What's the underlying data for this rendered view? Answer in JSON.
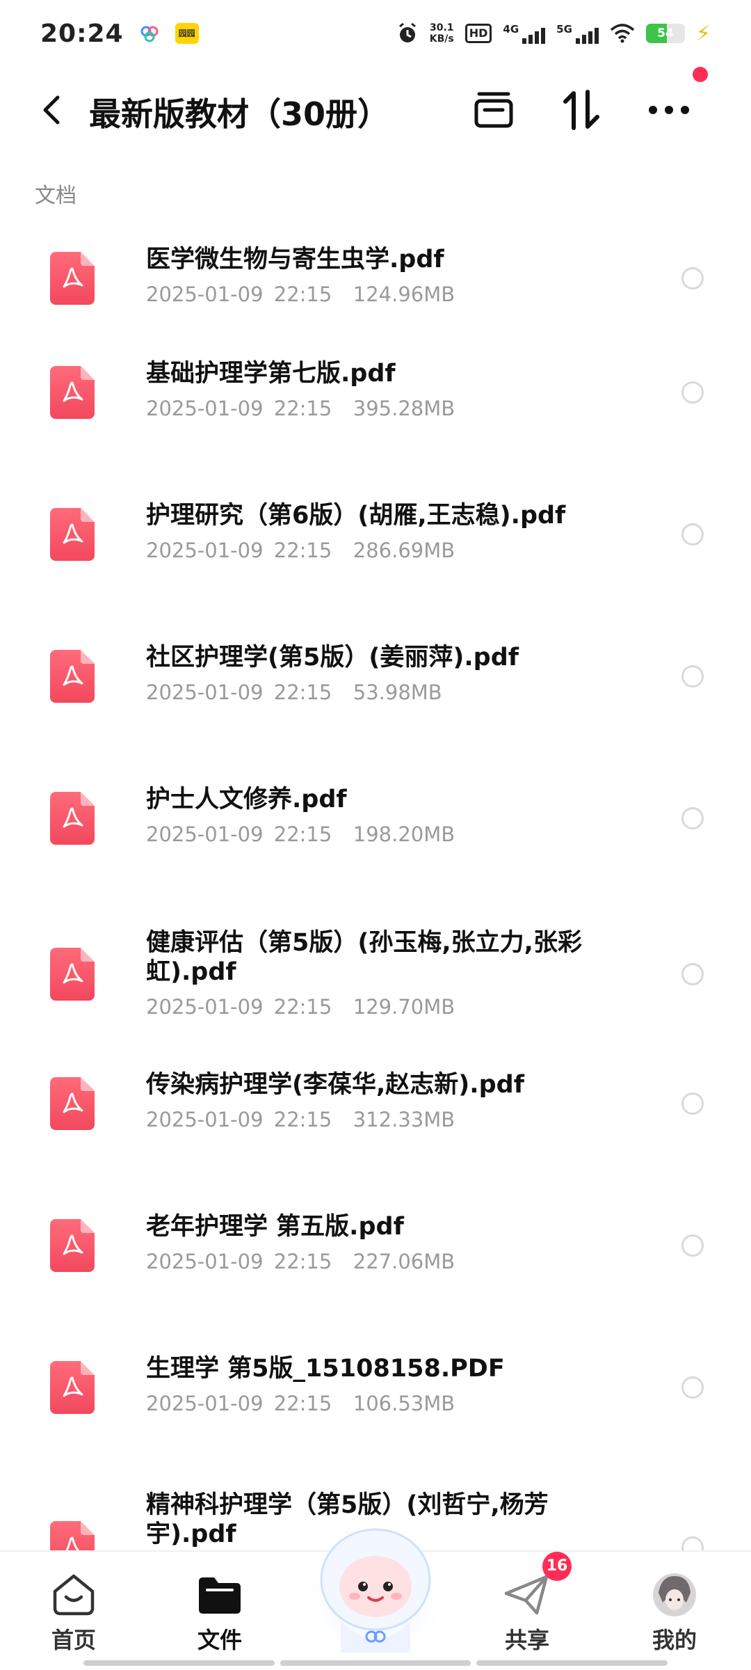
{
  "status_bar": {
    "time": "20:24",
    "app_badge": "园园",
    "net_speed_value": "30.1",
    "net_speed_unit": "KB/s",
    "hd_label": "HD",
    "sig1_label": "4G",
    "sig2_label": "5G",
    "battery_level": "54"
  },
  "header": {
    "title": "最新版教材（30册）"
  },
  "section": {
    "label": "文档"
  },
  "files": [
    {
      "name": "医学微生物与寄生虫学.pdf",
      "date": "2025-01-09 22:15",
      "size": "124.96MB"
    },
    {
      "name": "基础护理学第七版.pdf",
      "date": "2025-01-09 22:15",
      "size": "395.28MB"
    },
    {
      "name": "护理研究（第6版）(胡雁,王志稳).pdf",
      "date": "2025-01-09 22:15",
      "size": "286.69MB"
    },
    {
      "name": "社区护理学(第5版）(姜丽萍).pdf",
      "date": "2025-01-09 22:15",
      "size": "53.98MB"
    },
    {
      "name": "护士人文修养.pdf",
      "date": "2025-01-09 22:15",
      "size": "198.20MB"
    },
    {
      "name": "健康评估（第5版）(孙玉梅,张立力,张彩虹).pdf",
      "date": "2025-01-09 22:15",
      "size": "129.70MB"
    },
    {
      "name": "传染病护理学(李葆华,赵志新).pdf",
      "date": "2025-01-09 22:15",
      "size": "312.33MB"
    },
    {
      "name": "老年护理学 第五版.pdf",
      "date": "2025-01-09 22:15",
      "size": "227.06MB"
    },
    {
      "name": "生理学  第5版_15108158.PDF",
      "date": "2025-01-09 22:15",
      "size": "106.53MB"
    },
    {
      "name": "精神科护理学（第5版）(刘哲宁,杨芳宇).pdf",
      "date": "",
      "size": ""
    }
  ],
  "bottom_nav": {
    "home": "首页",
    "files": "文件",
    "share": "共享",
    "mine": "我的",
    "share_badge": "16"
  },
  "colors": {
    "pdf_icon": "#f2485d",
    "accent_dot": "#ff2d55",
    "meta_text": "#9a9a9a"
  }
}
